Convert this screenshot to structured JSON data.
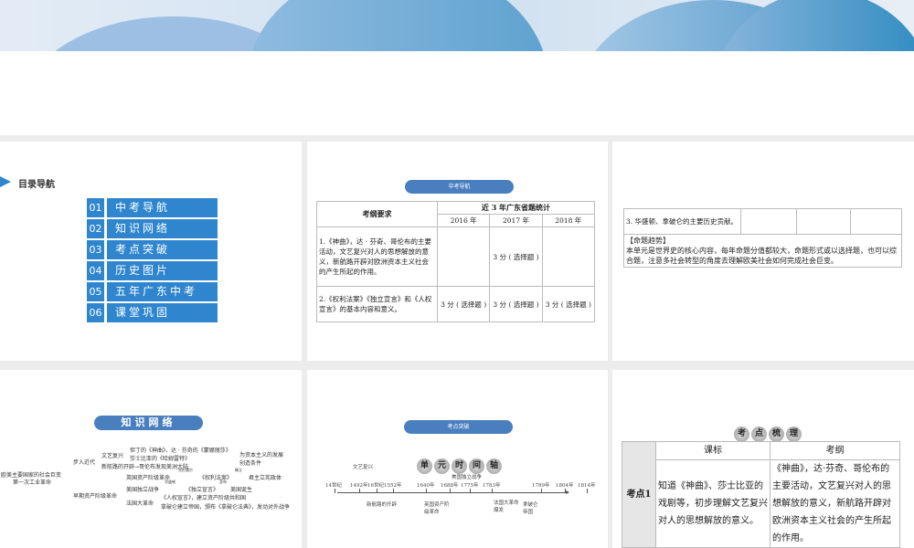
{
  "slide1": {
    "header": "目录导航",
    "items": [
      {
        "num": "01",
        "label": "中考导航"
      },
      {
        "num": "02",
        "label": "知识网络"
      },
      {
        "num": "03",
        "label": "考点突破"
      },
      {
        "num": "04",
        "label": "历史图片"
      },
      {
        "num": "05",
        "label": "五年广东中考"
      },
      {
        "num": "06",
        "label": "课堂巩固"
      }
    ]
  },
  "slide2": {
    "pill": "中考导航",
    "col1": "考纲要求",
    "stats_header": "近 3 年广东省题统计",
    "years": [
      "2016 年",
      "2017 年",
      "2018 年"
    ],
    "rows": [
      {
        "req": "1.《神曲》，达 · 芬奇、哥伦布的主要活动，文艺复兴对人的思想解放的意义，新航路开辟对欧洲资本主义社会的产生所起的作用。",
        "y2016": "",
        "y2017": "3 分 ( 选择题 )",
        "y2018": ""
      },
      {
        "req": "2.《权利法案》《独立宣言》和《人权宣言》的基本内容和意义。",
        "y2016": "3 分 ( 选择题 )",
        "y2017": "3 分 ( 选择题 )",
        "y2018": "3 分 ( 选择题 )"
      }
    ]
  },
  "slide3": {
    "row3": "3. 华盛顿、拿破仑的主要历史贡献。",
    "trend_title": "【命题趋势】",
    "trend_text": "本单元是世界史的核心内容，每年命题分值都较大，命题形式或以选择题，也可以综合题，注意多社会转型的角度去理解欧美社会如何完成社会巨变。"
  },
  "slide4": {
    "pill": "知识网络",
    "root1": "欧美主要国家的社会巨变",
    "root2": "第一次工业革命",
    "b1": "步入近代",
    "b2": "早期资产阶级革命",
    "wy": "文艺复兴",
    "wy1": "但丁的《神曲》、达 · 芬奇的《蒙娜丽莎》",
    "wy2": "莎士比亚的《哈姆雷特》",
    "xh": "新航路的开辟→哥伦布发现美洲大陆",
    "cond": "为资本主义的发展创造条件",
    "eng": "英国资产阶级革命",
    "eng_arrow": "克伦威尔",
    "eng_doc": "《权利法案》",
    "eng_arrow2": "确立",
    "eng_res": "君主立宪政体",
    "us": "美国独立战争",
    "us_arrow": "华盛顿",
    "us_doc": "《独立宣言》",
    "us_arrow2": "宣布",
    "us_res": "美国诞生",
    "fr": "法国大革命",
    "fr1": "《人权宣言》，建立资产阶级共和国",
    "fr2": "拿破仑建立帝国，颁布《拿破仑法典》，发动对外战争"
  },
  "slide5": {
    "pill": "考点突破",
    "title_chars": [
      "单",
      "元",
      "时",
      "间",
      "轴"
    ],
    "ticks": [
      "14世纪",
      "1492年",
      "16世纪",
      "1552年",
      "1640年",
      "1688年",
      "1775年",
      "1783年",
      "1789年",
      "1804年",
      "1814年"
    ],
    "above": [
      "文艺复兴",
      "美国独立战争"
    ],
    "below": [
      "新航路的开辟",
      "英国资产阶级革命",
      "法国大革命爆发",
      "拿破仑帝国"
    ]
  },
  "slide6": {
    "title_chars": [
      "考",
      "点",
      "梳",
      "理"
    ],
    "col_kb": "课标",
    "col_kg": "考纲",
    "row_label": "考点1",
    "kb": "知道《神曲》、莎士比亚的戏剧等，初步理解文艺复兴对人的思想解放的意义。",
    "kg": "《神曲》，达·芬奇、哥伦布的主要活动，文艺复兴对人的思想解放的意义，新航路开辟对欧洲资本主义社会的产生所起的作用。"
  }
}
